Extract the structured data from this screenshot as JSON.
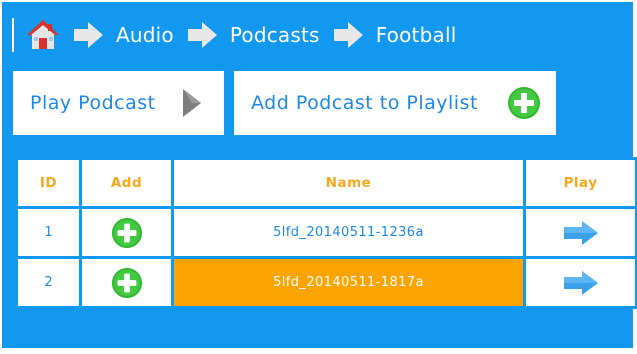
{
  "breadcrumb": {
    "home_icon": "home-icon",
    "items": [
      "Audio",
      "Podcasts",
      "Football"
    ]
  },
  "actions": {
    "play_label": "Play Podcast",
    "add_label": "Add Podcast to Playlist"
  },
  "table": {
    "headers": {
      "id": "ID",
      "add": "Add",
      "name": "Name",
      "play": "Play"
    },
    "rows": [
      {
        "id": "1",
        "name": "5lfd_20140511-1236a",
        "selected": false
      },
      {
        "id": "2",
        "name": "5lfd_20140511-1817a",
        "selected": true
      }
    ]
  },
  "colors": {
    "background": "#1298EE",
    "accent_text": "#1E88E5",
    "header_text": "#F5A81C",
    "selected_row": "#FBA300",
    "add_green": "#3CC43C"
  }
}
